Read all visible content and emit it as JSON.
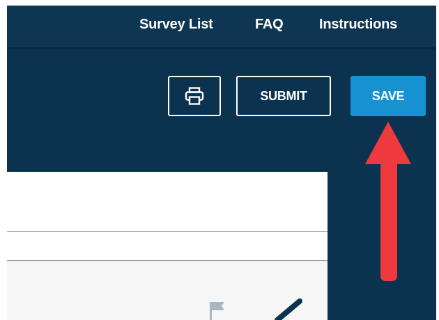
{
  "nav": {
    "links": [
      {
        "label": "Survey List"
      },
      {
        "label": "FAQ"
      },
      {
        "label": "Instructions"
      }
    ]
  },
  "toolbar": {
    "print_icon": "printer-icon",
    "submit_label": "SUBMIT",
    "save_label": "SAVE"
  },
  "panel": {
    "flag_icon": "flag-icon",
    "edit_icon": "pencil-icon"
  },
  "annotation": {
    "type": "arrow-up",
    "target": "save-button"
  },
  "colors": {
    "app_background": "#0b3350",
    "nav_background": "#0e3552",
    "save_button": "#1592cf",
    "annotation_arrow": "#ee3a3e",
    "panel_background": "#ffffff"
  }
}
